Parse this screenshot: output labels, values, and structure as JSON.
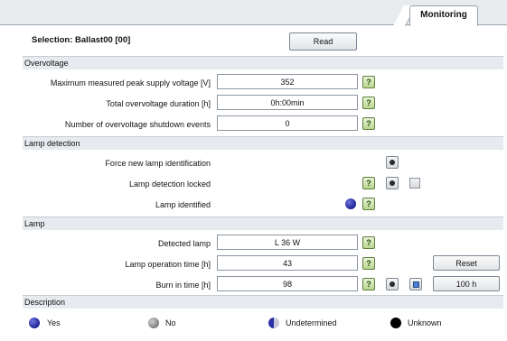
{
  "tabs": [
    {
      "label": "Monitoring"
    }
  ],
  "header": {
    "selection": "Selection: Ballast00 [00]",
    "read_label": "Read"
  },
  "overvoltage": {
    "title": "Overvoltage",
    "rows": [
      {
        "label": "Maximum measured peak supply voltage [V]",
        "value": "352",
        "help": "?"
      },
      {
        "label": "Total overvoltage duration [h]",
        "value": "0h:00min",
        "help": "?"
      },
      {
        "label": "Number of overvoltage shutdown events",
        "value": "0",
        "help": "?"
      }
    ]
  },
  "lamp_detection": {
    "title": "Lamp detection",
    "force_label": "Force new lamp identification",
    "locked_label": "Lamp detection locked",
    "locked_checked": false,
    "identified_label": "Lamp identified",
    "identified_state": "Yes",
    "help": "?"
  },
  "lamp": {
    "title": "Lamp",
    "detected_label": "Detected lamp",
    "detected_value": "L 36 W",
    "operation_label": "Lamp operation time [h]",
    "operation_value": "43",
    "reset_label": "Reset",
    "burn_label": "Burn in time [h]",
    "burn_value": "98",
    "burn_button_label": "100 h",
    "help": "?"
  },
  "description": {
    "title": "Description",
    "legend": [
      {
        "label": "Yes",
        "color": "#2a2fa8"
      },
      {
        "label": "No",
        "color": "#9a9a9a"
      },
      {
        "label": "Undetermined",
        "color": "#2a2fa8"
      },
      {
        "label": "Unknown",
        "color": "#000000"
      }
    ]
  }
}
